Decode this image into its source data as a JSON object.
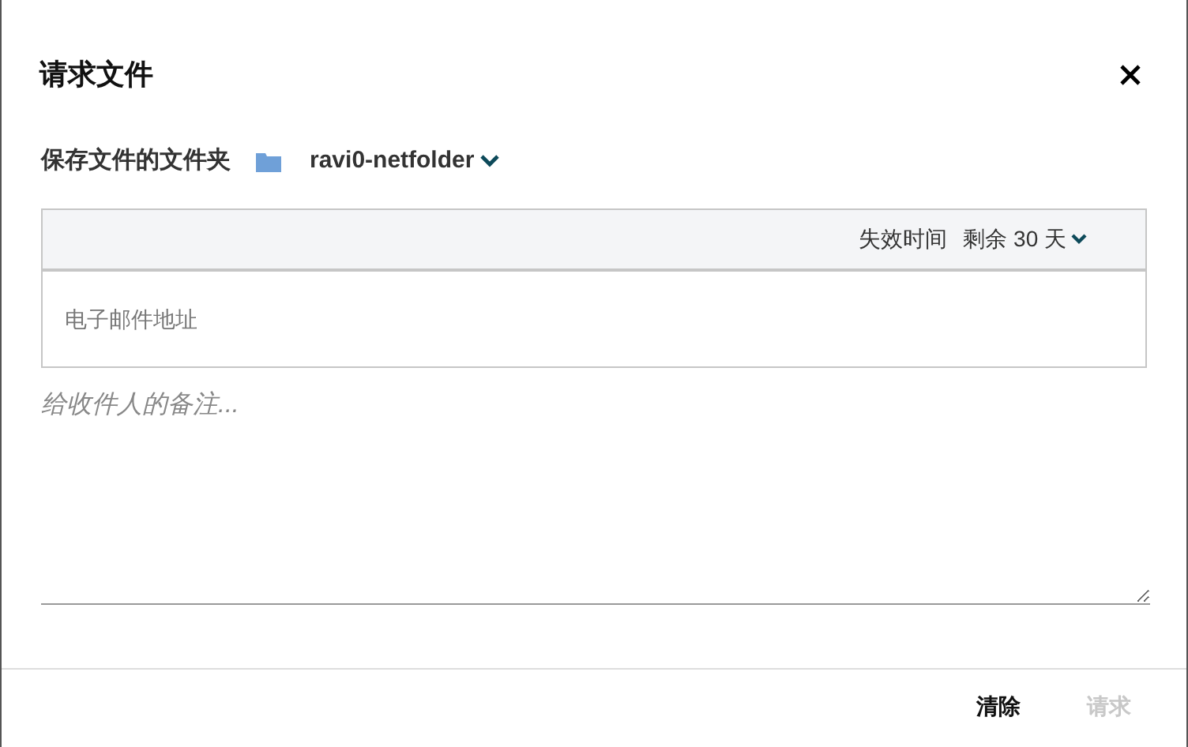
{
  "dialog": {
    "title": "请求文件"
  },
  "folder": {
    "label": "保存文件的文件夹",
    "name": "ravi0-netfolder"
  },
  "expiry": {
    "label": "失效时间",
    "value": "剩余 30 天"
  },
  "email": {
    "placeholder": "电子邮件地址"
  },
  "note": {
    "placeholder": "给收件人的备注..."
  },
  "buttons": [
    {
      "label": "清除",
      "disabled": false
    },
    {
      "label": "请求",
      "disabled": true
    }
  ]
}
